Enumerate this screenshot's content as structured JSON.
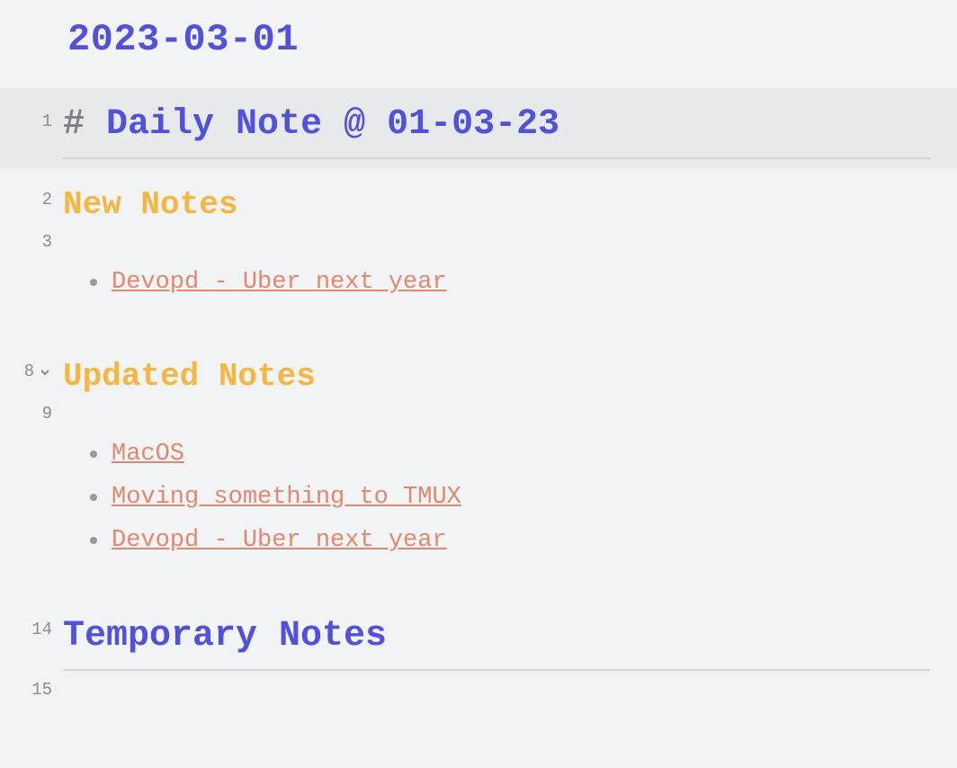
{
  "page": {
    "title": "2023-03-01"
  },
  "lines": [
    {
      "num": "1",
      "type": "h1",
      "hash": "#",
      "text": "Daily Note @ 01-03-23"
    },
    {
      "num": "2",
      "type": "h2y",
      "text": "New Notes"
    },
    {
      "num": "3",
      "type": "empty"
    },
    {
      "num": "",
      "type": "list",
      "text": "Devopd - Uber next year"
    },
    {
      "num": "",
      "type": "spacer"
    },
    {
      "num": "8",
      "type": "h2y",
      "text": "Updated Notes",
      "fold": true
    },
    {
      "num": "9",
      "type": "empty"
    },
    {
      "num": "",
      "type": "list",
      "text": "MacOS"
    },
    {
      "num": "",
      "type": "list",
      "text": "Moving something to TMUX"
    },
    {
      "num": "",
      "type": "list",
      "text": "Devopd - Uber next year"
    },
    {
      "num": "",
      "type": "spacer"
    },
    {
      "num": "14",
      "type": "h2b",
      "text": "Temporary Notes"
    },
    {
      "num": "15",
      "type": "empty"
    }
  ]
}
